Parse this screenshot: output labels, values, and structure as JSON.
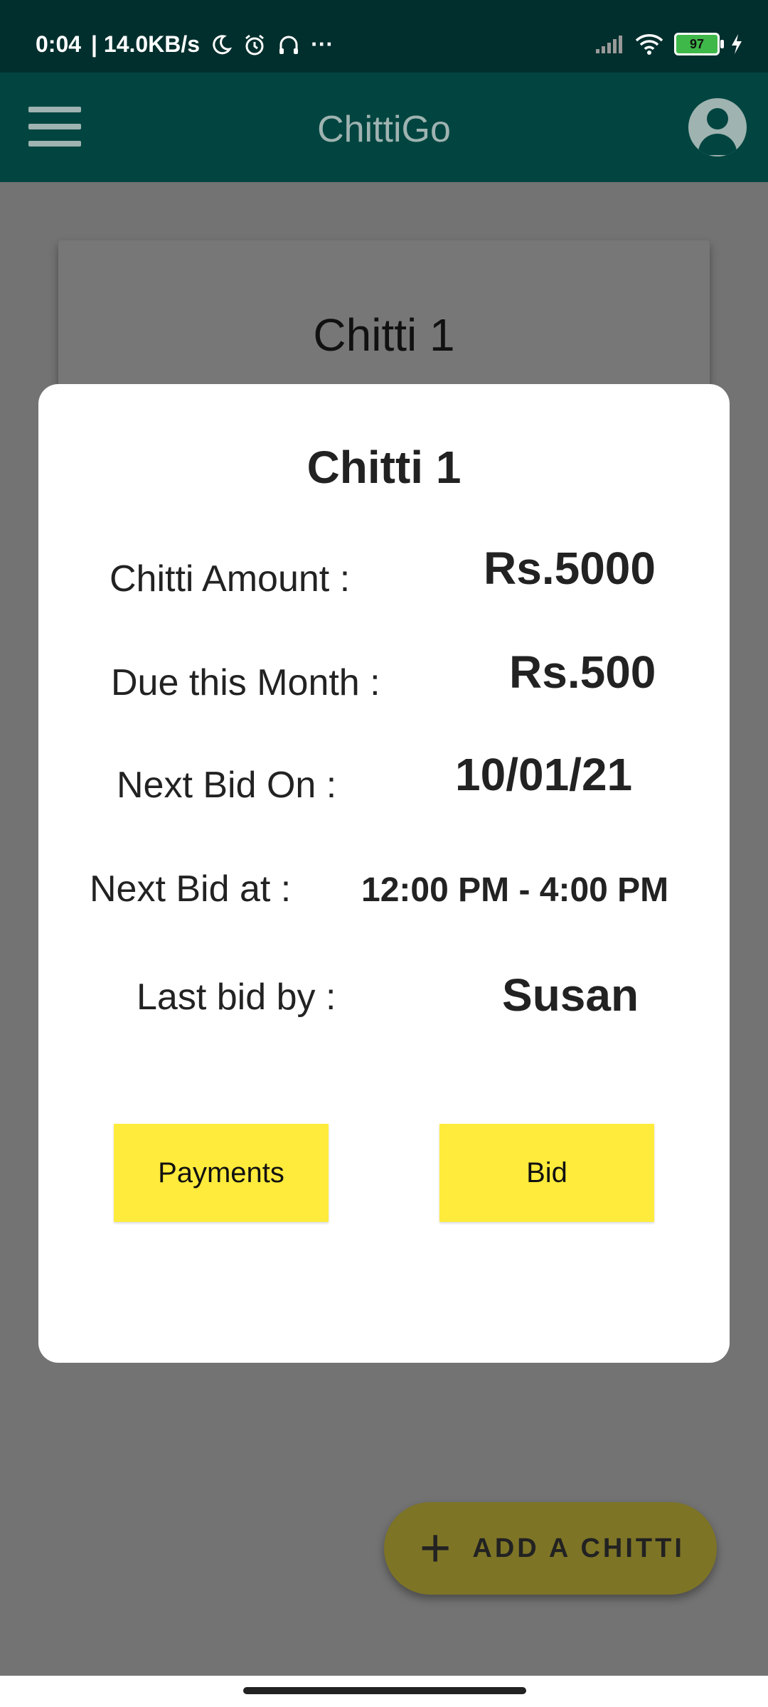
{
  "status_bar": {
    "time": "0:04",
    "speed": "| 14.0KB/s",
    "more": "···",
    "battery": "97"
  },
  "appbar": {
    "title": "ChittiGo"
  },
  "background_card": {
    "title": "Chitti 1"
  },
  "modal": {
    "title": "Chitti 1",
    "rows": [
      {
        "label": "Chitti Amount :",
        "value": "Rs.5000"
      },
      {
        "label": "Due this Month :",
        "value": "Rs.500"
      },
      {
        "label": "Next Bid On :",
        "value": "10/01/21"
      },
      {
        "label": "Next Bid at :",
        "value": "12:00 PM - 4:00 PM"
      },
      {
        "label": "Last bid by :",
        "value": "Susan"
      }
    ],
    "payments_label": "Payments",
    "bid_label": "Bid"
  },
  "fab": {
    "icon": "+",
    "label": "ADD A CHITTI"
  }
}
